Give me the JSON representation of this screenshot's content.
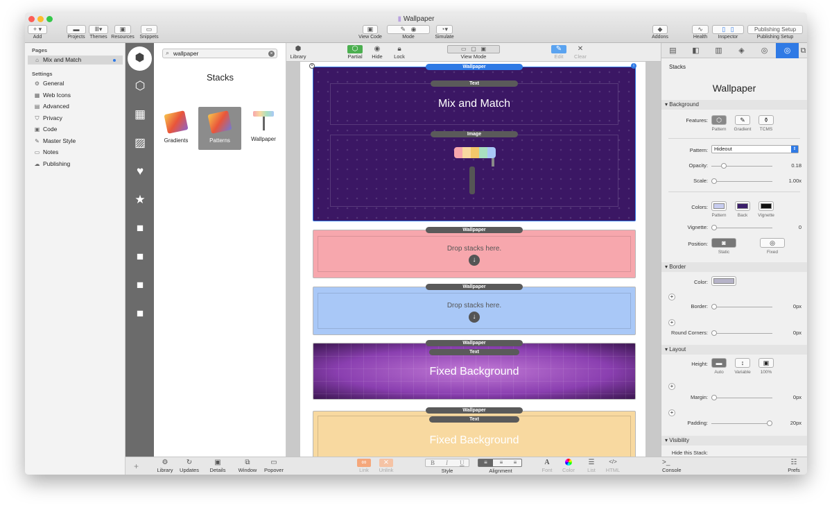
{
  "window": {
    "title": "Wallpaper"
  },
  "toolbar": {
    "add": "Add",
    "projects": "Projects",
    "themes": "Themes",
    "resources": "Resources",
    "snippets": "Snippets",
    "view_code": "View Code",
    "mode": "Mode",
    "simulate": "Simulate",
    "addons": "Addons",
    "health": "Health",
    "inspector": "Inspector",
    "publishing_setup_btn": "Publishing Setup",
    "publishing_setup": "Publishing Setup"
  },
  "left": {
    "pages_header": "Pages",
    "page_item": "Mix and Match",
    "settings_header": "Settings",
    "settings": [
      "General",
      "Web Icons",
      "Advanced",
      "Privacy",
      "Code",
      "Master Style",
      "Notes",
      "Publishing"
    ]
  },
  "library": {
    "search_value": "wallpaper",
    "heading": "Stacks",
    "items": [
      "Gradients",
      "Patterns",
      "Wallpaper"
    ],
    "selected": "Patterns"
  },
  "bottom": {
    "library": "Library",
    "updates": "Updates",
    "details": "Details",
    "window": "Window",
    "popover": "Popover",
    "link": "Link",
    "unlink": "Unlink",
    "style": "Style",
    "alignment": "Alignment",
    "font": "Font",
    "color": "Color",
    "list": "List",
    "html": "HTML",
    "console": "Console",
    "prefs": "Prefs",
    "bold": "B",
    "italic": "I",
    "underline": "U",
    "font_glyph": "A",
    "html_glyph": "</>"
  },
  "canvas_toolbar": {
    "library": "Library",
    "partial": "Partial",
    "hide": "Hide",
    "lock": "Lock",
    "view_mode": "View Mode",
    "edit": "Edit",
    "clear": "Clear"
  },
  "canvas": {
    "stack1": {
      "label": "Wallpaper",
      "text_pill": "Text",
      "title": "Mix and Match",
      "image_pill": "Image"
    },
    "stack2": {
      "label": "Wallpaper",
      "drop": "Drop stacks here."
    },
    "stack3": {
      "label": "Wallpaper",
      "drop": "Drop stacks here."
    },
    "stack4": {
      "label": "Wallpaper",
      "text_pill": "Text",
      "title": "Fixed Background"
    },
    "stack5": {
      "label": "Wallpaper",
      "text_pill": "Text",
      "title": "Fixed Background"
    }
  },
  "inspector": {
    "header": "Stacks",
    "title": "Wallpaper",
    "background": {
      "section": "Background",
      "features_label": "Features:",
      "features": [
        "Pattern",
        "Gradient",
        "TCMS"
      ],
      "pattern_label": "Pattern:",
      "pattern_value": "Hideout",
      "opacity_label": "Opacity:",
      "opacity_value": "0.18",
      "opacity": 0.18,
      "scale_label": "Scale:",
      "scale_value": "1.00x",
      "scale": 0.0,
      "colors_label": "Colors:",
      "colors": [
        "Pattern",
        "Back",
        "Vignette"
      ],
      "color_values": [
        "#c8cdf0",
        "#3b1f6b",
        "#111111"
      ],
      "vignette_label": "Vignette:",
      "vignette_value": "0",
      "vignette": 0,
      "position_label": "Position:",
      "positions": [
        "Static",
        "Fixed"
      ]
    },
    "border": {
      "section": "Border",
      "color_label": "Color:",
      "color_value": "#b6b3c8",
      "border_label": "Border:",
      "border_value": "0px",
      "border": 0,
      "corners_label": "Round Corners:",
      "corners_value": "0px",
      "corners": 0
    },
    "layout": {
      "section": "Layout",
      "height_label": "Height:",
      "heights": [
        "Auto",
        "Variable",
        "100%"
      ],
      "margin_label": "Margin:",
      "margin_value": "0px",
      "margin": 0,
      "padding_label": "Padding:",
      "padding_value": "20px",
      "padding": 1.0
    },
    "visibility": {
      "section": "Visibility",
      "hide_label": "Hide this Stack:"
    }
  },
  "colors": {
    "accent": "#2f7ae5",
    "purple": "#3b1764",
    "pink": "#f7a7ad",
    "blue": "#a9c8f7",
    "yellow": "#f8d9a0"
  }
}
